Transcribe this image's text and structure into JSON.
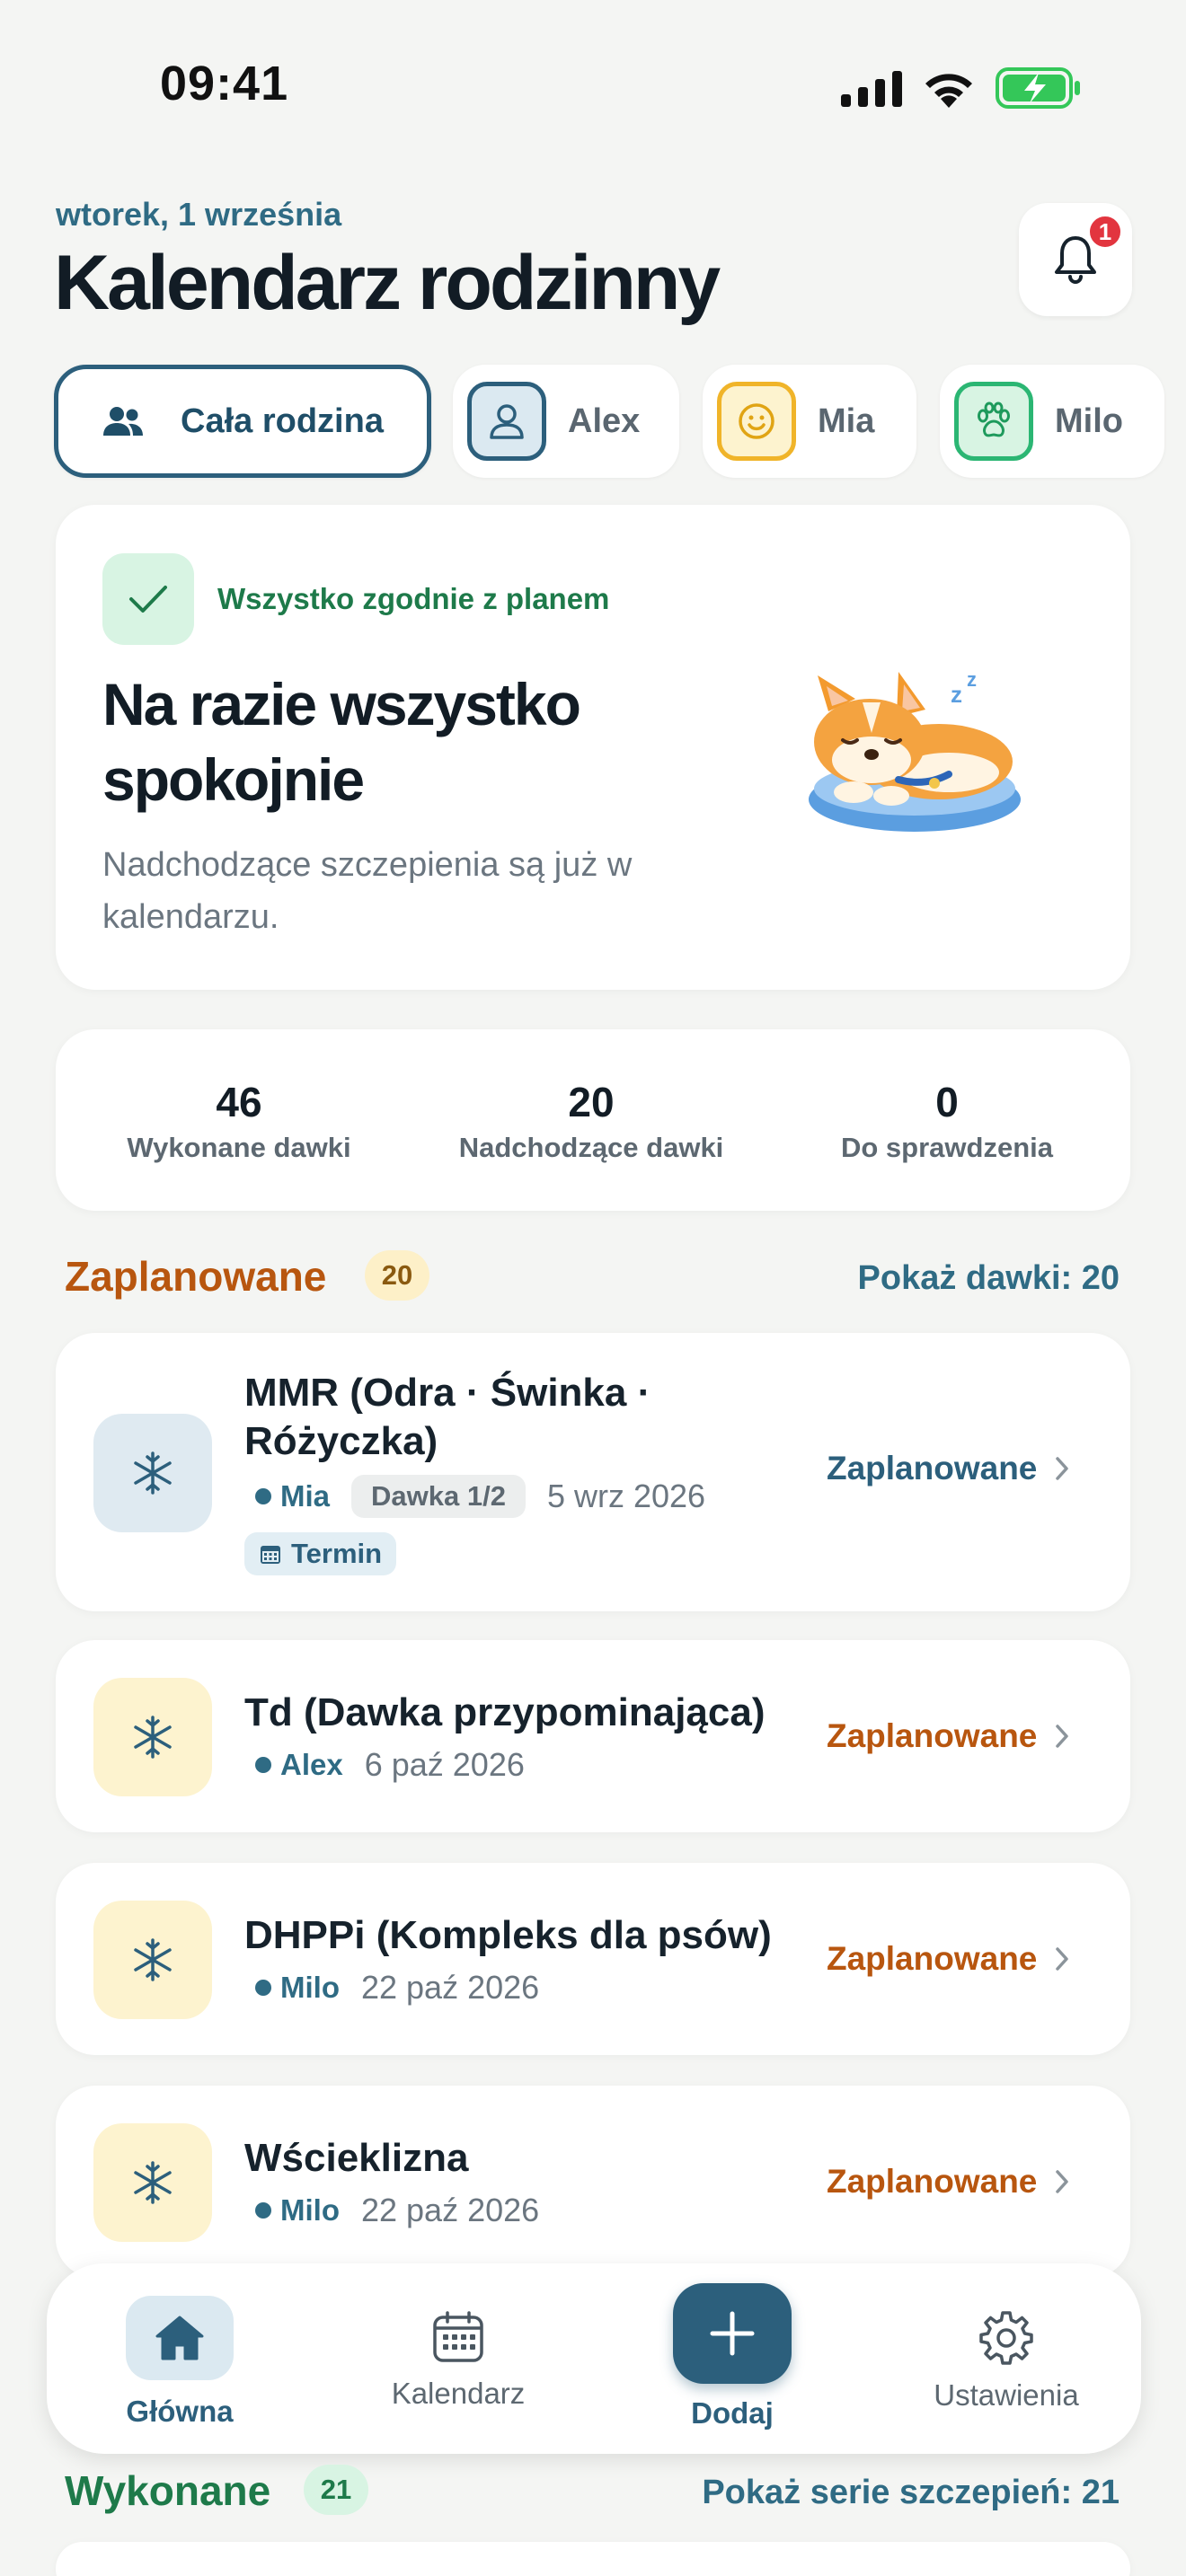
{
  "status_bar": {
    "time": "09:41"
  },
  "header": {
    "date": "wtorek, 1 września",
    "title": "Kalendarz rodzinny",
    "notification_count": "1"
  },
  "filters": [
    {
      "label": "Cała rodzina",
      "icon": "users-icon",
      "selected": true
    },
    {
      "label": "Alex",
      "icon": "person-icon",
      "color": "#2c5f7c"
    },
    {
      "label": "Mia",
      "icon": "smiley-icon",
      "color": "#f0b429"
    },
    {
      "label": "Milo",
      "icon": "paw-icon",
      "color": "#2bb673"
    }
  ],
  "hero": {
    "status": "Wszystko zgodnie z planem",
    "title": "Na razie wszystko spokojnie",
    "description": "Nadchodzące szczepienia są już w kalendarzu."
  },
  "stats": [
    {
      "value": "46",
      "label": "Wykonane dawki"
    },
    {
      "value": "20",
      "label": "Nadchodzące dawki"
    },
    {
      "value": "0",
      "label": "Do sprawdzenia"
    }
  ],
  "planned": {
    "title": "Zaplanowane",
    "count": "20",
    "link": "Pokaż dawki: 20",
    "items": [
      {
        "name_line1": "MMR (Odra · Świnka ·",
        "name_line2": "Różyczka)",
        "person": "Mia",
        "dose": "Dawka 1/2",
        "date": "5 wrz 2026",
        "tag": "Termin",
        "status": "Zaplanowane"
      },
      {
        "name": "Td (Dawka przypominająca)",
        "person": "Alex",
        "date": "6 paź 2026",
        "status": "Zaplanowane"
      },
      {
        "name": "DHPPi (Kompleks dla psów)",
        "person": "Milo",
        "date": "22 paź 2026",
        "status": "Zaplanowane"
      },
      {
        "name": "Wścieklizna",
        "person": "Milo",
        "date": "22 paź 2026",
        "status": "Zaplanowane"
      }
    ]
  },
  "done": {
    "title": "Wykonane",
    "count": "21",
    "link": "Pokaż serie szczepień: 21"
  },
  "nav": {
    "home": "Główna",
    "calendar": "Kalendarz",
    "add": "Dodaj",
    "settings": "Ustawienia"
  },
  "colors": {
    "primary": "#2c5f7c",
    "planned_orange": "#b8560f",
    "done_green": "#1e7a4a"
  }
}
